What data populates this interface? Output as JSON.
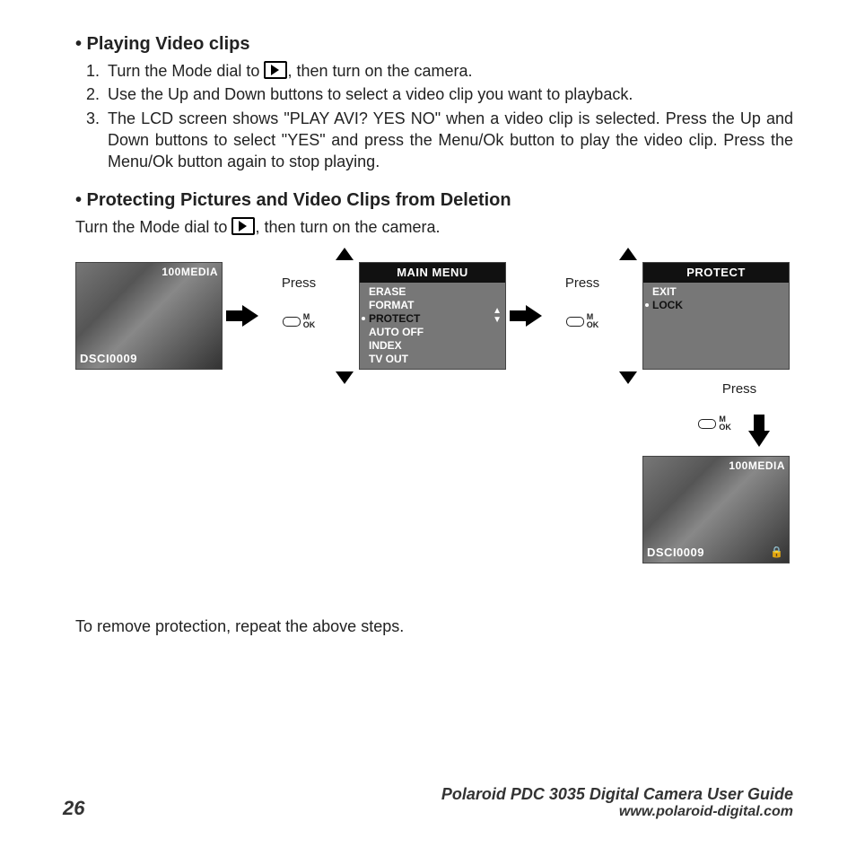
{
  "section1": {
    "title": "• Playing Video clips",
    "step1a": "Turn the Mode dial to ",
    "step1b": ", then turn on the camera.",
    "step2": "Use the Up and Down buttons to select a video clip you want to playback.",
    "step3": "The LCD screen shows \"PLAY AVI? YES NO\" when a video clip is selected. Press the Up and Down buttons to select \"YES\" and press the Menu/Ok button to play the video clip. Press the Menu/Ok button again to stop playing."
  },
  "section2": {
    "title": "• Protecting Pictures and Video Clips from Deletion",
    "bodyA": "Turn the Mode dial to ",
    "bodyB": ", then turn on the camera.",
    "after": "To remove protection, repeat the above steps."
  },
  "diagram": {
    "press": "Press",
    "ok_m": "M",
    "ok_ok": "OK",
    "lcd_top": "100MEDIA",
    "lcd_bot": "DSCI0009",
    "main_menu": {
      "title": "MAIN MENU",
      "items": [
        "ERASE",
        "FORMAT",
        "PROTECT",
        "AUTO OFF",
        "INDEX",
        "TV OUT"
      ],
      "selected": 2
    },
    "protect_menu": {
      "title": "PROTECT",
      "items": [
        "EXIT",
        "LOCK"
      ],
      "selected": 1
    }
  },
  "footer": {
    "page": "26",
    "guide": "Polaroid PDC 3035 Digital Camera User Guide",
    "url": "www.polaroid-digital.com"
  }
}
